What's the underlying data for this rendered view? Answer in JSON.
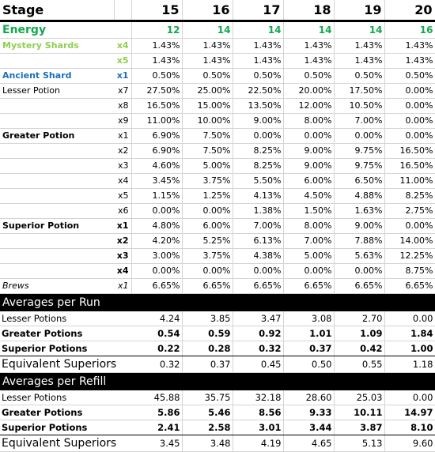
{
  "header": {
    "title": "Stage",
    "stages": [
      "15",
      "16",
      "17",
      "18",
      "19",
      "20"
    ]
  },
  "energy": {
    "label": "Energy",
    "values": [
      "12",
      "14",
      "14",
      "14",
      "14",
      "16"
    ]
  },
  "colors": {
    "energy": "#12a84d",
    "mystery": "#8fcf4e",
    "ancient": "#1b6fbd",
    "section_bg": "#000000"
  },
  "drops": [
    {
      "label": "Mystery Shards",
      "mult": "x4",
      "style": "mystery",
      "values": [
        "1.43%",
        "1.43%",
        "1.43%",
        "1.43%",
        "1.43%",
        "1.43%"
      ]
    },
    {
      "label": "",
      "mult": "x5",
      "style": "mystery",
      "values": [
        "1.43%",
        "1.43%",
        "1.43%",
        "1.43%",
        "1.43%",
        "1.43%"
      ]
    },
    {
      "label": "Ancient Shard",
      "mult": "x1",
      "style": "ancient",
      "values": [
        "0.50%",
        "0.50%",
        "0.50%",
        "0.50%",
        "0.50%",
        "0.50%"
      ]
    },
    {
      "label": "Lesser Potion",
      "mult": "x7",
      "style": "plain",
      "values": [
        "27.50%",
        "25.00%",
        "22.50%",
        "20.00%",
        "17.50%",
        "0.00%"
      ]
    },
    {
      "label": "",
      "mult": "x8",
      "style": "plain",
      "values": [
        "16.50%",
        "15.00%",
        "13.50%",
        "12.00%",
        "10.50%",
        "0.00%"
      ]
    },
    {
      "label": "",
      "mult": "x9",
      "style": "plain",
      "values": [
        "11.00%",
        "10.00%",
        "9.00%",
        "8.00%",
        "7.00%",
        "0.00%"
      ]
    },
    {
      "label": "Greater Potion",
      "mult": "x1",
      "style": "greater",
      "values": [
        "6.90%",
        "7.50%",
        "0.00%",
        "0.00%",
        "0.00%",
        "0.00%"
      ]
    },
    {
      "label": "",
      "mult": "x2",
      "style": "greater",
      "values": [
        "6.90%",
        "7.50%",
        "8.25%",
        "9.00%",
        "9.75%",
        "16.50%"
      ]
    },
    {
      "label": "",
      "mult": "x3",
      "style": "greater",
      "values": [
        "4.60%",
        "5.00%",
        "8.25%",
        "9.00%",
        "9.75%",
        "16.50%"
      ]
    },
    {
      "label": "",
      "mult": "x4",
      "style": "greater",
      "values": [
        "3.45%",
        "3.75%",
        "5.50%",
        "6.00%",
        "6.50%",
        "11.00%"
      ]
    },
    {
      "label": "",
      "mult": "x5",
      "style": "greater",
      "values": [
        "1.15%",
        "1.25%",
        "4.13%",
        "4.50%",
        "4.88%",
        "8.25%"
      ]
    },
    {
      "label": "",
      "mult": "x6",
      "style": "greater",
      "values": [
        "0.00%",
        "0.00%",
        "1.38%",
        "1.50%",
        "1.63%",
        "2.75%"
      ]
    },
    {
      "label": "Superior Potion",
      "mult": "x1",
      "style": "superior",
      "values": [
        "4.80%",
        "6.00%",
        "7.00%",
        "8.00%",
        "9.00%",
        "0.00%"
      ]
    },
    {
      "label": "",
      "mult": "x2",
      "style": "superior",
      "values": [
        "4.20%",
        "5.25%",
        "6.13%",
        "7.00%",
        "7.88%",
        "14.00%"
      ]
    },
    {
      "label": "",
      "mult": "x3",
      "style": "superior",
      "values": [
        "3.00%",
        "3.75%",
        "4.38%",
        "5.00%",
        "5.63%",
        "12.25%"
      ]
    },
    {
      "label": "",
      "mult": "x4",
      "style": "superior",
      "values": [
        "0.00%",
        "0.00%",
        "0.00%",
        "0.00%",
        "0.00%",
        "8.75%"
      ]
    },
    {
      "label": "Brews",
      "mult": "x1",
      "style": "brews",
      "values": [
        "6.65%",
        "6.65%",
        "6.65%",
        "6.65%",
        "6.65%",
        "6.65%"
      ]
    }
  ],
  "sections": [
    {
      "title": "Averages per Run",
      "rows": [
        {
          "label": "Lesser Potions",
          "kind": "lesser",
          "values": [
            "4.24",
            "3.85",
            "3.47",
            "3.08",
            "2.70",
            "0.00"
          ]
        },
        {
          "label": "Greater Potions",
          "kind": "greater",
          "values": [
            "0.54",
            "0.59",
            "0.92",
            "1.01",
            "1.09",
            "1.84"
          ]
        },
        {
          "label": "Superior Potions",
          "kind": "sup",
          "values": [
            "0.22",
            "0.28",
            "0.32",
            "0.37",
            "0.42",
            "1.00"
          ]
        },
        {
          "label": "Equivalent Superiors",
          "kind": "equiv",
          "values": [
            "0.32",
            "0.37",
            "0.45",
            "0.50",
            "0.55",
            "1.18"
          ]
        }
      ]
    },
    {
      "title": "Averages per Refill",
      "rows": [
        {
          "label": "Lesser Potions",
          "kind": "lesser",
          "values": [
            "45.88",
            "35.75",
            "32.18",
            "28.60",
            "25.03",
            "0.00"
          ]
        },
        {
          "label": "Greater Potions",
          "kind": "greater",
          "values": [
            "5.86",
            "5.46",
            "8.56",
            "9.33",
            "10.11",
            "14.97"
          ]
        },
        {
          "label": "Superior Potions",
          "kind": "sup",
          "values": [
            "2.41",
            "2.58",
            "3.01",
            "3.44",
            "3.87",
            "8.10"
          ]
        },
        {
          "label": "Equivalent Superiors",
          "kind": "equiv",
          "values": [
            "3.45",
            "3.48",
            "4.19",
            "4.65",
            "5.13",
            "9.60"
          ]
        }
      ]
    }
  ]
}
